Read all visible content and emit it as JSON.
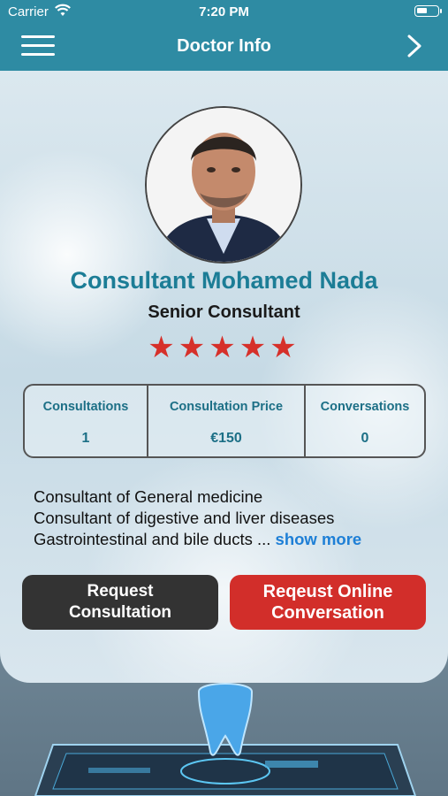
{
  "status_bar": {
    "carrier": "Carrier",
    "time": "7:20 PM"
  },
  "header": {
    "title": "Doctor Info"
  },
  "doctor": {
    "name": "Consultant Mohamed Nada",
    "title": "Senior Consultant",
    "rating_stars": "★★★★★"
  },
  "stats": [
    {
      "label": "Consultations",
      "value": "1"
    },
    {
      "label": "Consultation Price",
      "value": "€150"
    },
    {
      "label": "Conversations",
      "value": "0"
    }
  ],
  "bio": {
    "line1": "Consultant of General medicine",
    "line2": "Consultant of digestive and liver diseases",
    "line3": "Gastrointestinal and bile ducts ...",
    "show_more": "show more"
  },
  "buttons": {
    "request_line1": "Request",
    "request_line2": "Consultation",
    "online_line1": "Reqeust Online",
    "online_line2": "Conversation"
  },
  "colors": {
    "header": "#2e8ba3",
    "accent": "#1c7d96",
    "star": "#d6302a",
    "danger": "#d22e2a"
  }
}
